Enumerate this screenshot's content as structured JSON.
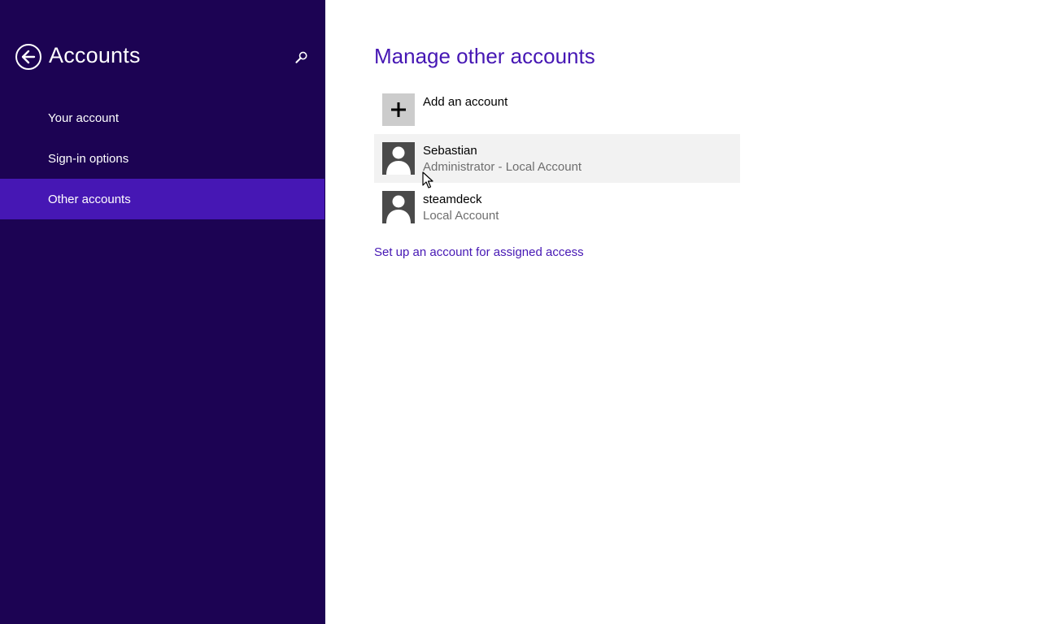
{
  "sidebar": {
    "title": "Accounts",
    "back_icon": "back-arrow-icon",
    "search_icon": "search-icon",
    "items": [
      {
        "label": "Your account"
      },
      {
        "label": "Sign-in options"
      },
      {
        "label": "Other accounts",
        "selected": true
      }
    ]
  },
  "main": {
    "title": "Manage other accounts",
    "add_account": {
      "label": "Add an account",
      "icon": "plus-icon"
    },
    "accounts": [
      {
        "name": "Sebastian",
        "type": "Administrator - Local Account",
        "icon": "user-avatar-icon"
      },
      {
        "name": "steamdeck",
        "type": "Local Account",
        "icon": "user-avatar-icon"
      }
    ],
    "assigned_access_link": "Set up an account for assigned access"
  },
  "colors": {
    "sidebar_bg": "#1c0353",
    "accent": "#4617b4",
    "hover_row": "#f2f2f2"
  }
}
